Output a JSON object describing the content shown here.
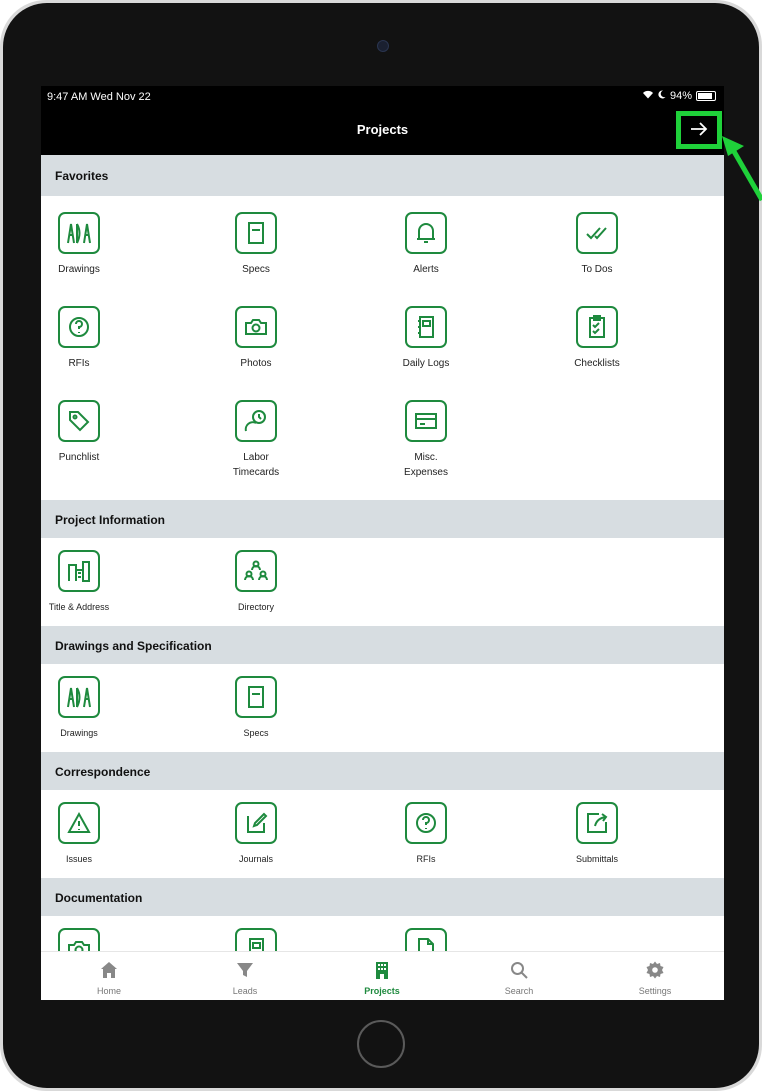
{
  "status_bar": {
    "time": "9:47 AM   Wed Nov 22",
    "battery": "94%"
  },
  "navbar": {
    "title": "Projects",
    "forward_icon": "arrow-right-icon"
  },
  "highlight_color": "#1fd13a",
  "accent_color": "#1e8a3e",
  "sections": [
    {
      "title": "Favorites",
      "items": [
        "Drawings",
        "Specs",
        "Alerts",
        "To Dos",
        "RFIs",
        "Photos",
        "Daily Logs",
        "Checklists",
        "Punchlist",
        "Labor\nTimecards",
        "Misc.\nExpenses"
      ]
    },
    {
      "title": "Project Information",
      "items": [
        "Title & Address",
        "Directory"
      ]
    },
    {
      "title": "Drawings and Specification",
      "items": [
        "Drawings",
        "Specs"
      ]
    },
    {
      "title": "Correspondence",
      "items": [
        "Issues",
        "Journals",
        "RFIs",
        "Submittals"
      ]
    },
    {
      "title": "Documentation",
      "items": []
    }
  ],
  "tab_bar": {
    "tabs": [
      {
        "label": "Home",
        "icon": "home-icon"
      },
      {
        "label": "Leads",
        "icon": "filter-icon"
      },
      {
        "label": "Projects",
        "icon": "building-icon"
      },
      {
        "label": "Search",
        "icon": "search-icon"
      },
      {
        "label": "Settings",
        "icon": "gear-icon"
      }
    ],
    "active": "Projects"
  }
}
